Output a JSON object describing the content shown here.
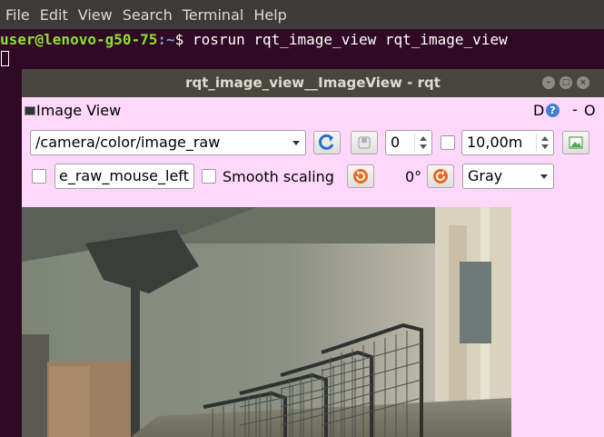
{
  "menubar": {
    "items": [
      "File",
      "Edit",
      "View",
      "Search",
      "Terminal",
      "Help"
    ]
  },
  "terminal": {
    "user_host": "user@lenovo-g50-75",
    "path": ":~",
    "prompt_symbol": "$",
    "command": " rosrun rqt_image_view rqt_image_view"
  },
  "window": {
    "title": "rqt_image_view__ImageView - rqt"
  },
  "dock": {
    "title": "Image View",
    "d_label": "D",
    "help_label": "?",
    "minus_label": "-",
    "o_label": "O"
  },
  "toolbar": {
    "topic": "/camera/color/image_raw",
    "spin_value": "0",
    "zoom_value": "10,00m",
    "mouse_topic": "e_raw_mouse_left",
    "smooth_label": "Smooth scaling",
    "rotation": "0°",
    "color_scheme": "Gray"
  },
  "icons": {
    "refresh": "refresh-icon",
    "save": "save-icon",
    "fit": "fit-icon",
    "rotate_left": "rotate-left-icon",
    "rotate_right": "rotate-right-icon"
  },
  "colors": {
    "window_bg": "#fdd8fa",
    "terminal_bg": "#300a24",
    "titlebar": "#48463f"
  }
}
